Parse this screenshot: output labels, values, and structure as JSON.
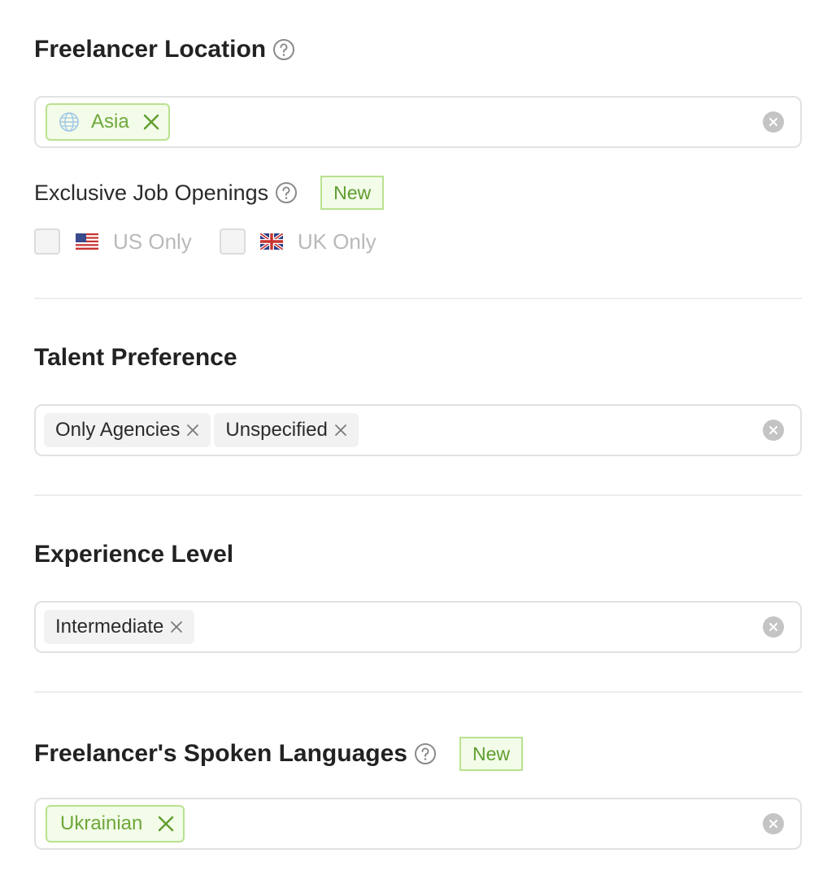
{
  "freelancer_location": {
    "title": "Freelancer Location",
    "tags": [
      {
        "label": "Asia"
      }
    ]
  },
  "exclusive_jobs": {
    "title": "Exclusive Job Openings",
    "badge": "New",
    "options": [
      {
        "label": "US Only",
        "checked": false,
        "flag": "us-flag-icon"
      },
      {
        "label": "UK Only",
        "checked": false,
        "flag": "uk-flag-icon"
      }
    ]
  },
  "talent_preference": {
    "title": "Talent Preference",
    "tags": [
      {
        "label": "Only Agencies"
      },
      {
        "label": "Unspecified"
      }
    ]
  },
  "experience_level": {
    "title": "Experience Level",
    "tags": [
      {
        "label": "Intermediate"
      }
    ]
  },
  "spoken_languages": {
    "title": "Freelancer's Spoken Languages",
    "badge": "New",
    "tags": [
      {
        "label": "Ukrainian"
      }
    ]
  },
  "colors": {
    "accent_green": "#6ea83a",
    "tag_green_bg": "#f3fbe9",
    "tag_green_border": "#b9e28f"
  }
}
